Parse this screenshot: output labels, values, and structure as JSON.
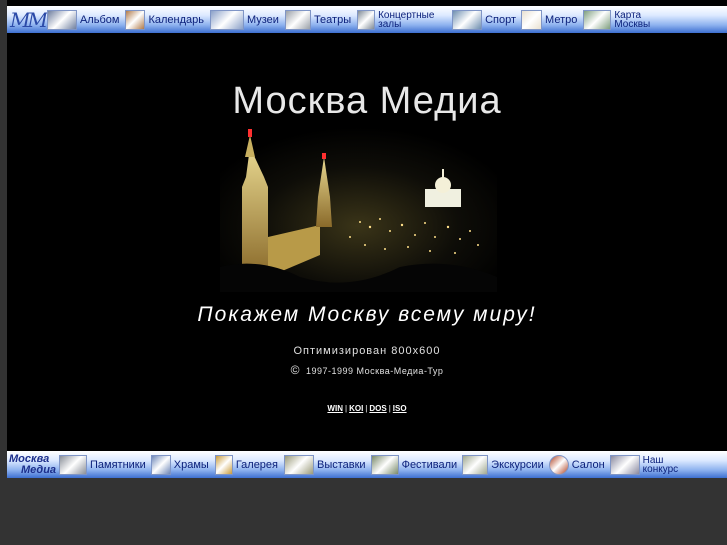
{
  "top_nav": {
    "logo": "MM",
    "items": [
      {
        "label": "Альбом",
        "icon": "album-photo-icon",
        "color": "#6f7f9f"
      },
      {
        "label": "Календарь",
        "icon": "calendar-icon",
        "color": "#b07a4a"
      },
      {
        "label": "Музеи",
        "icon": "museum-icon",
        "color": "#8aa0c8"
      },
      {
        "label": "Театры",
        "icon": "theatre-icon",
        "color": "#9aa0a8"
      },
      {
        "label": "Концертные залы",
        "icon": "concert-hall-icon",
        "color": "#7f8a96"
      },
      {
        "label": "Спорт",
        "icon": "sport-icon",
        "color": "#6f8fb0"
      },
      {
        "label": "Метро",
        "icon": "metro-map-icon",
        "color": "#e8e0d0"
      },
      {
        "label": "Карта Москвы",
        "icon": "moscow-map-icon",
        "color": "#7f9f7f"
      }
    ]
  },
  "main": {
    "title": "Москва Медиа",
    "slogan": "Покажем Москву всему миру!",
    "optimized": "Оптимизирован 800х600",
    "copyright_symbol": "©",
    "copyright": "1997-1999 Москва-Медиа-Тур",
    "encodings": [
      "WIN",
      "KOI",
      "DOS",
      "ISO"
    ]
  },
  "bottom_nav": {
    "logo_line1": "Москва",
    "logo_line2": "Медиа",
    "items": [
      {
        "label": "Памятники",
        "icon": "monument-icon",
        "color": "#8a8f98"
      },
      {
        "label": "Храмы",
        "icon": "church-icon",
        "color": "#6f88b8"
      },
      {
        "label": "Галерея",
        "icon": "gallery-icon",
        "color": "#c89a3a"
      },
      {
        "label": "Выставки",
        "icon": "exhibition-icon",
        "color": "#9a9a7a"
      },
      {
        "label": "Фестивали",
        "icon": "festival-icon",
        "color": "#7a8a6a"
      },
      {
        "label": "Экскурсии",
        "icon": "excursion-icon",
        "color": "#a0a890"
      },
      {
        "label": "Салон",
        "icon": "salon-icon",
        "color": "#b04020"
      },
      {
        "label": "Наш конкурс",
        "icon": "contest-icon",
        "color": "#8a8aa0"
      }
    ]
  }
}
